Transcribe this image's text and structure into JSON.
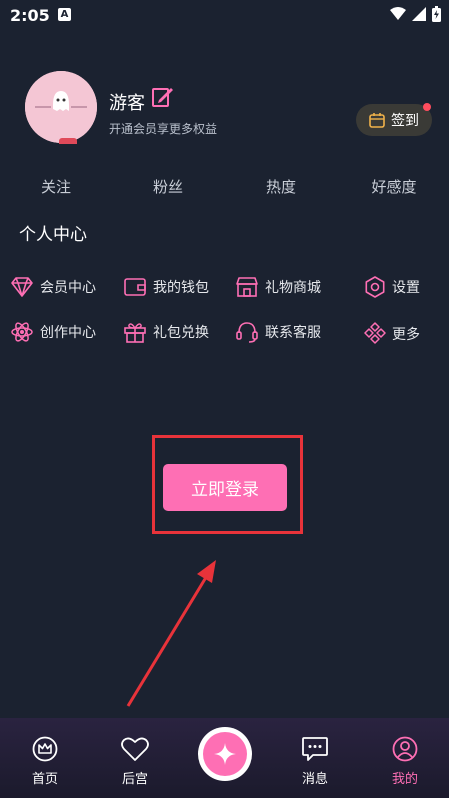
{
  "status_bar": {
    "time": "2:05",
    "notif_badge": "A"
  },
  "profile": {
    "username": "游客",
    "vip_tip": "开通会员享更多权益",
    "checkin_label": "签到"
  },
  "stats": [
    "关注",
    "粉丝",
    "热度",
    "好感度"
  ],
  "section_title": "个人中心",
  "menu": [
    {
      "label": "会员中心",
      "icon": "diamond-icon"
    },
    {
      "label": "我的钱包",
      "icon": "wallet-icon"
    },
    {
      "label": "礼物商城",
      "icon": "store-icon"
    },
    {
      "label": "设置",
      "icon": "gear-icon"
    },
    {
      "label": "创作中心",
      "icon": "atom-icon"
    },
    {
      "label": "礼包兑换",
      "icon": "gift-icon"
    },
    {
      "label": "联系客服",
      "icon": "headset-icon"
    },
    {
      "label": "更多",
      "icon": "more-diamonds-icon"
    }
  ],
  "login_button": "立即登录",
  "nav": [
    {
      "label": "首页",
      "icon": "crown-icon"
    },
    {
      "label": "后宫",
      "icon": "heart-icon"
    },
    {
      "label": "消息",
      "icon": "message-icon"
    },
    {
      "label": "我的",
      "icon": "user-icon"
    }
  ],
  "colors": {
    "accent": "#fe6fb4",
    "background": "#1b2230",
    "highlight": "#e8333a"
  }
}
